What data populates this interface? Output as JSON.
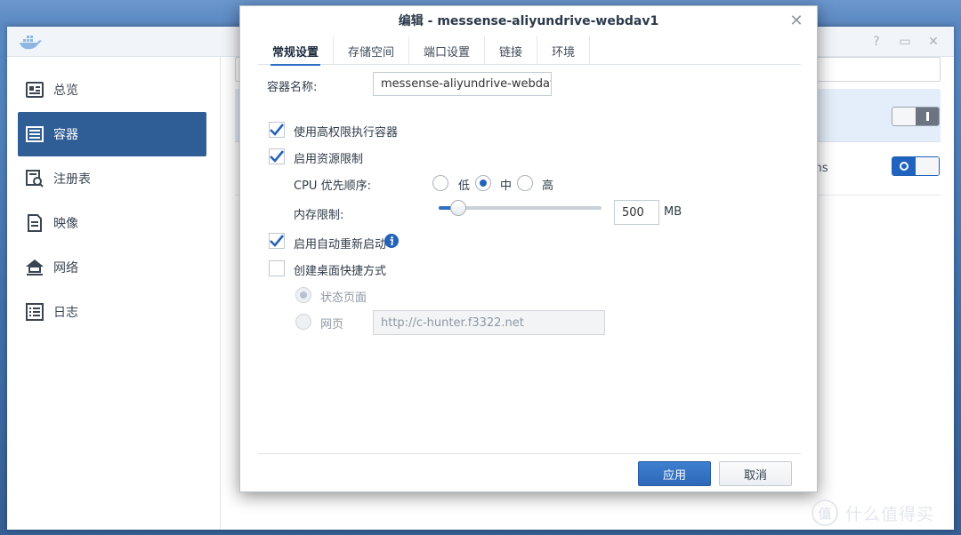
{
  "background_app": {
    "window_controls": [
      "?",
      "▭",
      "✕"
    ],
    "sidebar": {
      "items": [
        {
          "label": "总览",
          "icon": "overview-icon"
        },
        {
          "label": "容器",
          "icon": "container-icon",
          "active": true
        },
        {
          "label": "注册表",
          "icon": "registry-icon"
        },
        {
          "label": "映像",
          "icon": "image-icon"
        },
        {
          "label": "网络",
          "icon": "network-icon"
        },
        {
          "label": "日志",
          "icon": "log-icon"
        }
      ]
    },
    "search_fragment": "e",
    "row2_fragment": "ains"
  },
  "dialog": {
    "title": "编辑 - messense-aliyundrive-webdav1",
    "tabs": [
      {
        "label": "常规设置",
        "active": true
      },
      {
        "label": "存储空间"
      },
      {
        "label": "端口设置"
      },
      {
        "label": "链接"
      },
      {
        "label": "环境"
      }
    ],
    "general": {
      "container_name_label": "容器名称:",
      "container_name_value": "messense-aliyundrive-webdav1",
      "privileged_label": "使用高权限执行容器",
      "privileged_checked": true,
      "resource_limit_label": "启用资源限制",
      "resource_limit_checked": true,
      "cpu_priority_label": "CPU 优先顺序:",
      "cpu_options": [
        "低",
        "中",
        "高"
      ],
      "cpu_selected": "中",
      "memory_limit_label": "内存限制:",
      "memory_value": "500",
      "memory_unit": "MB",
      "memory_slider_fraction": 0.12,
      "auto_restart_label": "启用自动重新启动",
      "auto_restart_checked": true,
      "shortcut_label": "创建桌面快捷方式",
      "shortcut_checked": false,
      "shortcut_option_status": "状态页面",
      "shortcut_option_web": "网页",
      "shortcut_url": "http://c-hunter.f3322.net"
    },
    "buttons": {
      "apply": "应用",
      "cancel": "取消"
    }
  },
  "watermark": {
    "badge": "值",
    "text": "什么值得买"
  },
  "colors": {
    "accent": "#2f6fc4",
    "sidebar_active": "#2f5d95",
    "check": "#2563b8"
  }
}
